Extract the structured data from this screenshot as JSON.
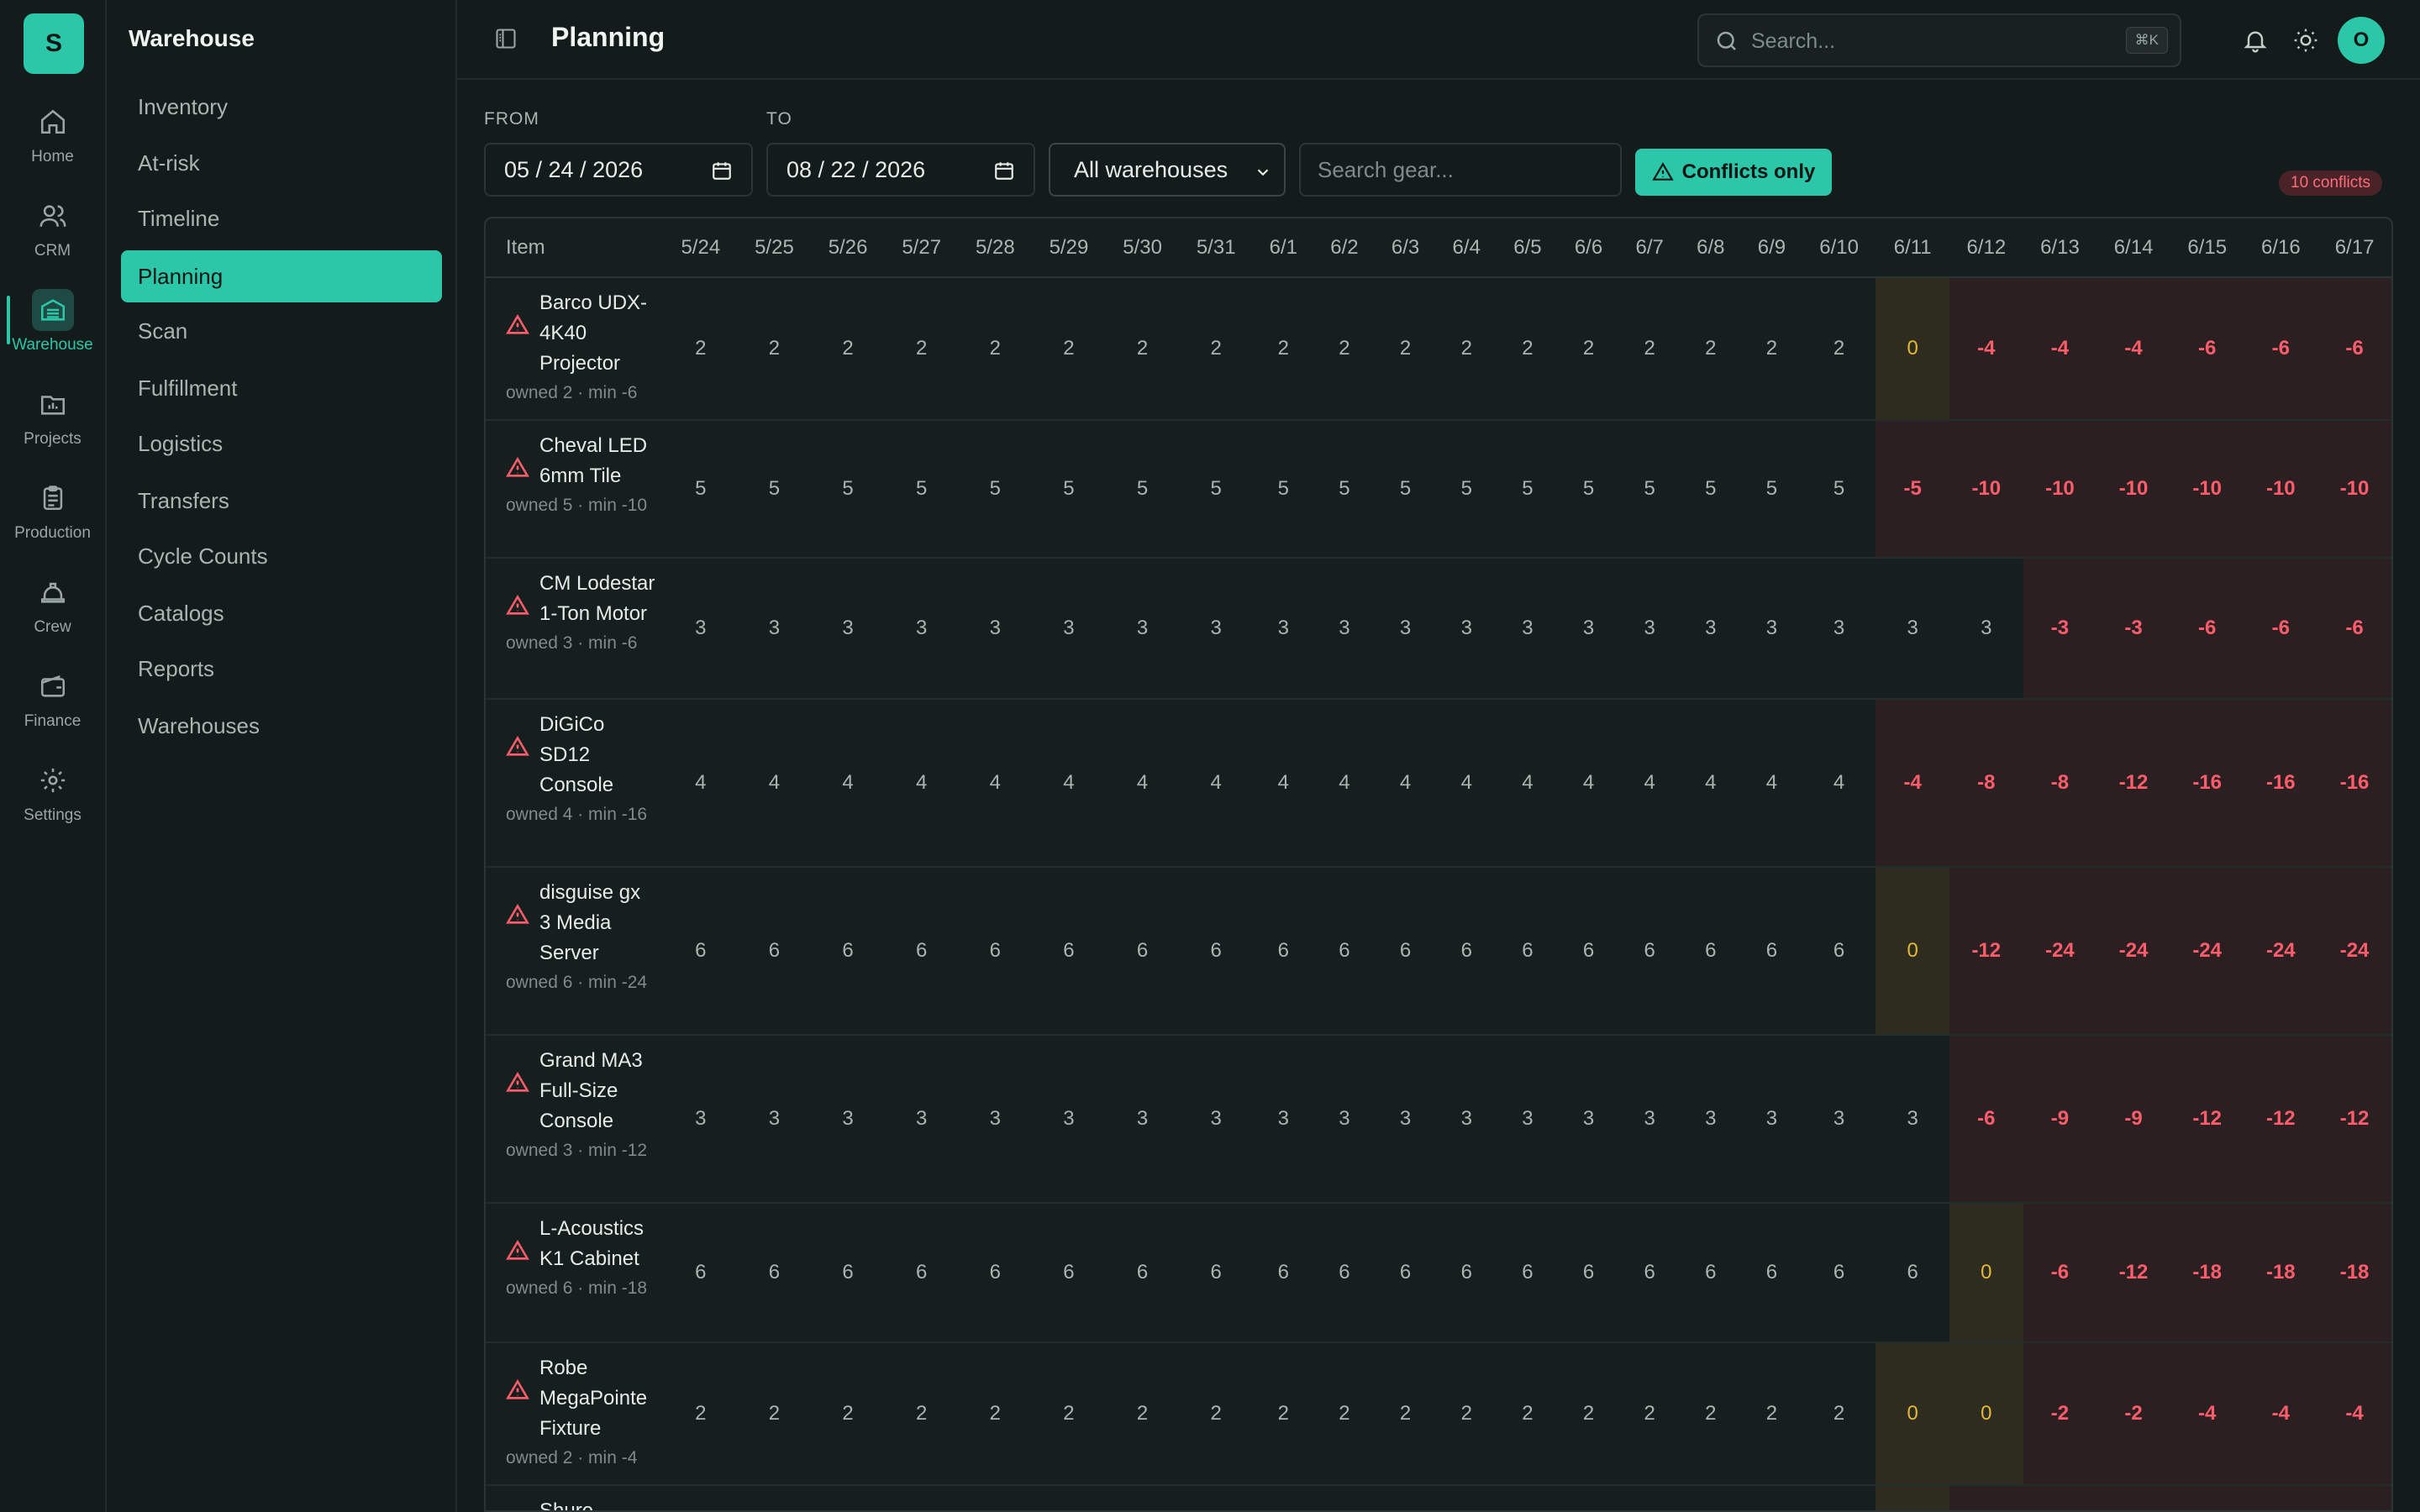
{
  "app": {
    "logo_letter": "S"
  },
  "rail": [
    {
      "id": "home",
      "label": "Home",
      "icon": "home-icon",
      "active": false
    },
    {
      "id": "crm",
      "label": "CRM",
      "icon": "users-icon",
      "active": false
    },
    {
      "id": "warehouse",
      "label": "Warehouse",
      "icon": "warehouse-icon",
      "active": true
    },
    {
      "id": "projects",
      "label": "Projects",
      "icon": "folder-chart-icon",
      "active": false
    },
    {
      "id": "production",
      "label": "Production",
      "icon": "clipboard-icon",
      "active": false
    },
    {
      "id": "crew",
      "label": "Crew",
      "icon": "hard-hat-icon",
      "active": false
    },
    {
      "id": "finance",
      "label": "Finance",
      "icon": "wallet-icon",
      "active": false
    },
    {
      "id": "settings",
      "label": "Settings",
      "icon": "gear-icon",
      "active": false
    }
  ],
  "subnav": {
    "title": "Warehouse",
    "items": [
      {
        "label": "Inventory",
        "active": false
      },
      {
        "label": "At-risk",
        "active": false
      },
      {
        "label": "Timeline",
        "active": false
      },
      {
        "label": "Planning",
        "active": true
      },
      {
        "label": "Scan",
        "active": false
      },
      {
        "label": "Fulfillment",
        "active": false
      },
      {
        "label": "Logistics",
        "active": false
      },
      {
        "label": "Transfers",
        "active": false
      },
      {
        "label": "Cycle Counts",
        "active": false
      },
      {
        "label": "Catalogs",
        "active": false
      },
      {
        "label": "Reports",
        "active": false
      },
      {
        "label": "Warehouses",
        "active": false
      }
    ]
  },
  "header": {
    "title": "Planning",
    "search_placeholder": "Search...",
    "search_shortcut": "⌘K",
    "avatar_initial": "O"
  },
  "filters": {
    "from_label": "FROM",
    "from_value": "05 / 24 / 2026",
    "to_label": "TO",
    "to_value": "08 / 22 / 2026",
    "warehouse_value": "All warehouses",
    "gear_search_placeholder": "Search gear...",
    "conflicts_button": "Conflicts only",
    "conflict_count": "10 conflicts"
  },
  "grid": {
    "item_header": "Item",
    "dates": [
      "5/24",
      "5/25",
      "5/26",
      "5/27",
      "5/28",
      "5/29",
      "5/30",
      "5/31",
      "6/1",
      "6/2",
      "6/3",
      "6/4",
      "6/5",
      "6/6",
      "6/7",
      "6/8",
      "6/9",
      "6/10",
      "6/11",
      "6/12",
      "6/13",
      "6/14",
      "6/15",
      "6/16",
      "6/17"
    ],
    "rows": [
      {
        "name": "Barco UDX-4K40 Projector",
        "owned": "owned 2 · min -6",
        "values": [
          "2",
          "2",
          "2",
          "2",
          "2",
          "2",
          "2",
          "2",
          "2",
          "2",
          "2",
          "2",
          "2",
          "2",
          "2",
          "2",
          "2",
          "2",
          "0",
          "-4",
          "-4",
          "-4",
          "-6",
          "-6",
          "-6"
        ]
      },
      {
        "name": "Cheval LED 6mm Tile",
        "owned": "owned 5 · min -10",
        "values": [
          "5",
          "5",
          "5",
          "5",
          "5",
          "5",
          "5",
          "5",
          "5",
          "5",
          "5",
          "5",
          "5",
          "5",
          "5",
          "5",
          "5",
          "5",
          "-5",
          "-10",
          "-10",
          "-10",
          "-10",
          "-10",
          "-10"
        ]
      },
      {
        "name": "CM Lodestar 1-Ton Motor",
        "owned": "owned 3 · min -6",
        "values": [
          "3",
          "3",
          "3",
          "3",
          "3",
          "3",
          "3",
          "3",
          "3",
          "3",
          "3",
          "3",
          "3",
          "3",
          "3",
          "3",
          "3",
          "3",
          "3",
          "3",
          "-3",
          "-3",
          "-6",
          "-6",
          "-6"
        ]
      },
      {
        "name": "DiGiCo SD12 Console",
        "owned": "owned 4 · min -16",
        "values": [
          "4",
          "4",
          "4",
          "4",
          "4",
          "4",
          "4",
          "4",
          "4",
          "4",
          "4",
          "4",
          "4",
          "4",
          "4",
          "4",
          "4",
          "4",
          "-4",
          "-8",
          "-8",
          "-12",
          "-16",
          "-16",
          "-16"
        ]
      },
      {
        "name": "disguise gx 3 Media Server",
        "owned": "owned 6 · min -24",
        "values": [
          "6",
          "6",
          "6",
          "6",
          "6",
          "6",
          "6",
          "6",
          "6",
          "6",
          "6",
          "6",
          "6",
          "6",
          "6",
          "6",
          "6",
          "6",
          "0",
          "-12",
          "-24",
          "-24",
          "-24",
          "-24",
          "-24"
        ]
      },
      {
        "name": "Grand MA3 Full-Size Console",
        "owned": "owned 3 · min -12",
        "values": [
          "3",
          "3",
          "3",
          "3",
          "3",
          "3",
          "3",
          "3",
          "3",
          "3",
          "3",
          "3",
          "3",
          "3",
          "3",
          "3",
          "3",
          "3",
          "3",
          "-6",
          "-9",
          "-9",
          "-12",
          "-12",
          "-12"
        ]
      },
      {
        "name": "L-Acoustics K1 Cabinet",
        "owned": "owned 6 · min -18",
        "values": [
          "6",
          "6",
          "6",
          "6",
          "6",
          "6",
          "6",
          "6",
          "6",
          "6",
          "6",
          "6",
          "6",
          "6",
          "6",
          "6",
          "6",
          "6",
          "6",
          "0",
          "-6",
          "-12",
          "-18",
          "-18",
          "-18"
        ]
      },
      {
        "name": "Robe MegaPointe Fixture",
        "owned": "owned 2 · min -4",
        "values": [
          "2",
          "2",
          "2",
          "2",
          "2",
          "2",
          "2",
          "2",
          "2",
          "2",
          "2",
          "2",
          "2",
          "2",
          "2",
          "2",
          "2",
          "2",
          "0",
          "0",
          "-2",
          "-2",
          "-4",
          "-4",
          "-4"
        ]
      },
      {
        "name": "Shure",
        "owned": "",
        "values": [
          "",
          "",
          "",
          "",
          "",
          "",
          "",
          "",
          "",
          "",
          "",
          "",
          "",
          "",
          "",
          "",
          "",
          "",
          "",
          "",
          "",
          "",
          "",
          "",
          ""
        ]
      }
    ]
  },
  "colors": {
    "accent": "#2bc7a8",
    "negative": "#ff5d6c",
    "zero": "#e3b83a"
  }
}
